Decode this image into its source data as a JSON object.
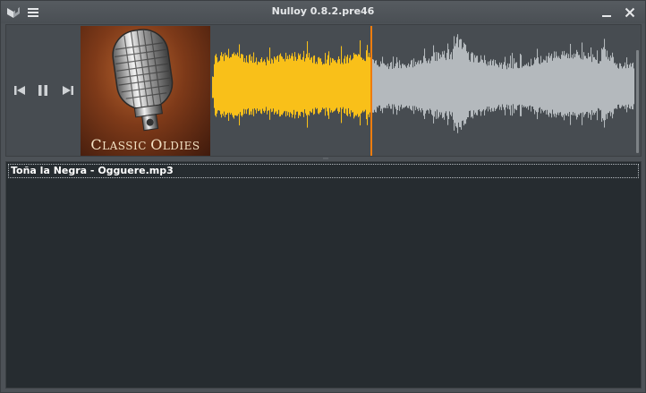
{
  "window": {
    "title": "Nulloy 0.8.2.pre46"
  },
  "icons": {
    "app": "nulloy-logo-icon",
    "menu": "hamburger-menu-icon",
    "minimize": "minimize-icon",
    "close": "close-icon",
    "prev": "skip-previous-icon",
    "pause": "pause-icon",
    "next": "skip-next-icon"
  },
  "player": {
    "cover_art_text_main": "C",
    "cover_art_text_rest": "LASSIC ",
    "cover_art_text_main2": "O",
    "cover_art_text_rest2": "LDIES",
    "progress": 0.375,
    "colors": {
      "played": "#f9c019",
      "remaining": "#b4b9bd",
      "playhead": "#ef7d0e"
    }
  },
  "playlist": {
    "items": [
      {
        "label": "Toña la Negra - Ogguere.mp3"
      }
    ]
  }
}
